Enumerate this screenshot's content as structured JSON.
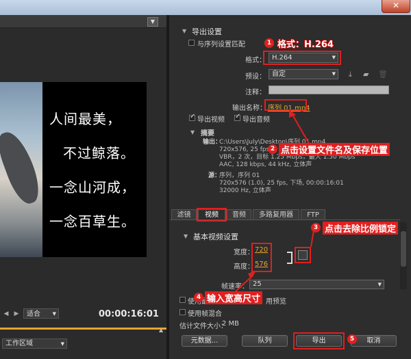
{
  "window": {
    "close_glyph": "✕"
  },
  "left": {
    "poem_lines": [
      "人间最美，",
      "不过鲸落。",
      "一念山河成，",
      "一念百草生。"
    ],
    "fit_select": "适合",
    "timecode": "00:00:16:01",
    "workarea_select": "工作区域"
  },
  "export_settings": {
    "section_title": "导出设置",
    "match_sequence_label": "与序列设置匹配",
    "format_label": "格式：",
    "format_value": "H.264",
    "preset_label": "预设：",
    "preset_value": "自定",
    "comment_label": "注释：",
    "comment_value": "",
    "output_name_label": "输出名称：",
    "output_name_value": "序列 01.mp4",
    "export_video_label": "导出视频",
    "export_audio_label": "导出音频"
  },
  "summary": {
    "title": "摘要",
    "output_key": "输出：",
    "output_lines": [
      "C:\\Users\\July\\Desktop\\序列 01.mp4",
      "720x576, 25 fps, ",
      "VBR，2 次，目标 1.25 Mbps，最大 1.50 Mbps",
      "AAC, 128 kbps, 44 kHz, 立体声"
    ],
    "source_key": "源：",
    "source_lines": [
      "序列，序列 01",
      "720x576 (1.0), 25 fps, 下场, 00:00:16:01",
      "32000 Hz, 立体声"
    ]
  },
  "tabs": [
    "滤镜",
    "视频",
    "音频",
    "多路复用器",
    "FTP"
  ],
  "video_settings": {
    "title": "基本视频设置",
    "width_label": "宽度：",
    "width_value": "720",
    "height_label": "高度：",
    "height_value": "576",
    "frame_rate_label": "帧速率：",
    "frame_rate_value": "25"
  },
  "bottom": {
    "max_render_label": "使用最高渲染质量",
    "preview_label": "用预览",
    "blend_label": "使用帧混合",
    "estimate_label": "估计文件大小：",
    "estimate_value": "2 MB",
    "metadata_button": "元数据...",
    "queue_button": "队列",
    "export_button": "导出",
    "cancel_button": "取消"
  },
  "annotations": {
    "a1": "格式：H.264",
    "a2": "点击设置文件名及保存位置",
    "a3": "点击去除比例锁定",
    "a4": "输入宽高尺寸",
    "n1": "1",
    "n2": "2",
    "n3": "3",
    "n4": "4",
    "n5": "5"
  }
}
